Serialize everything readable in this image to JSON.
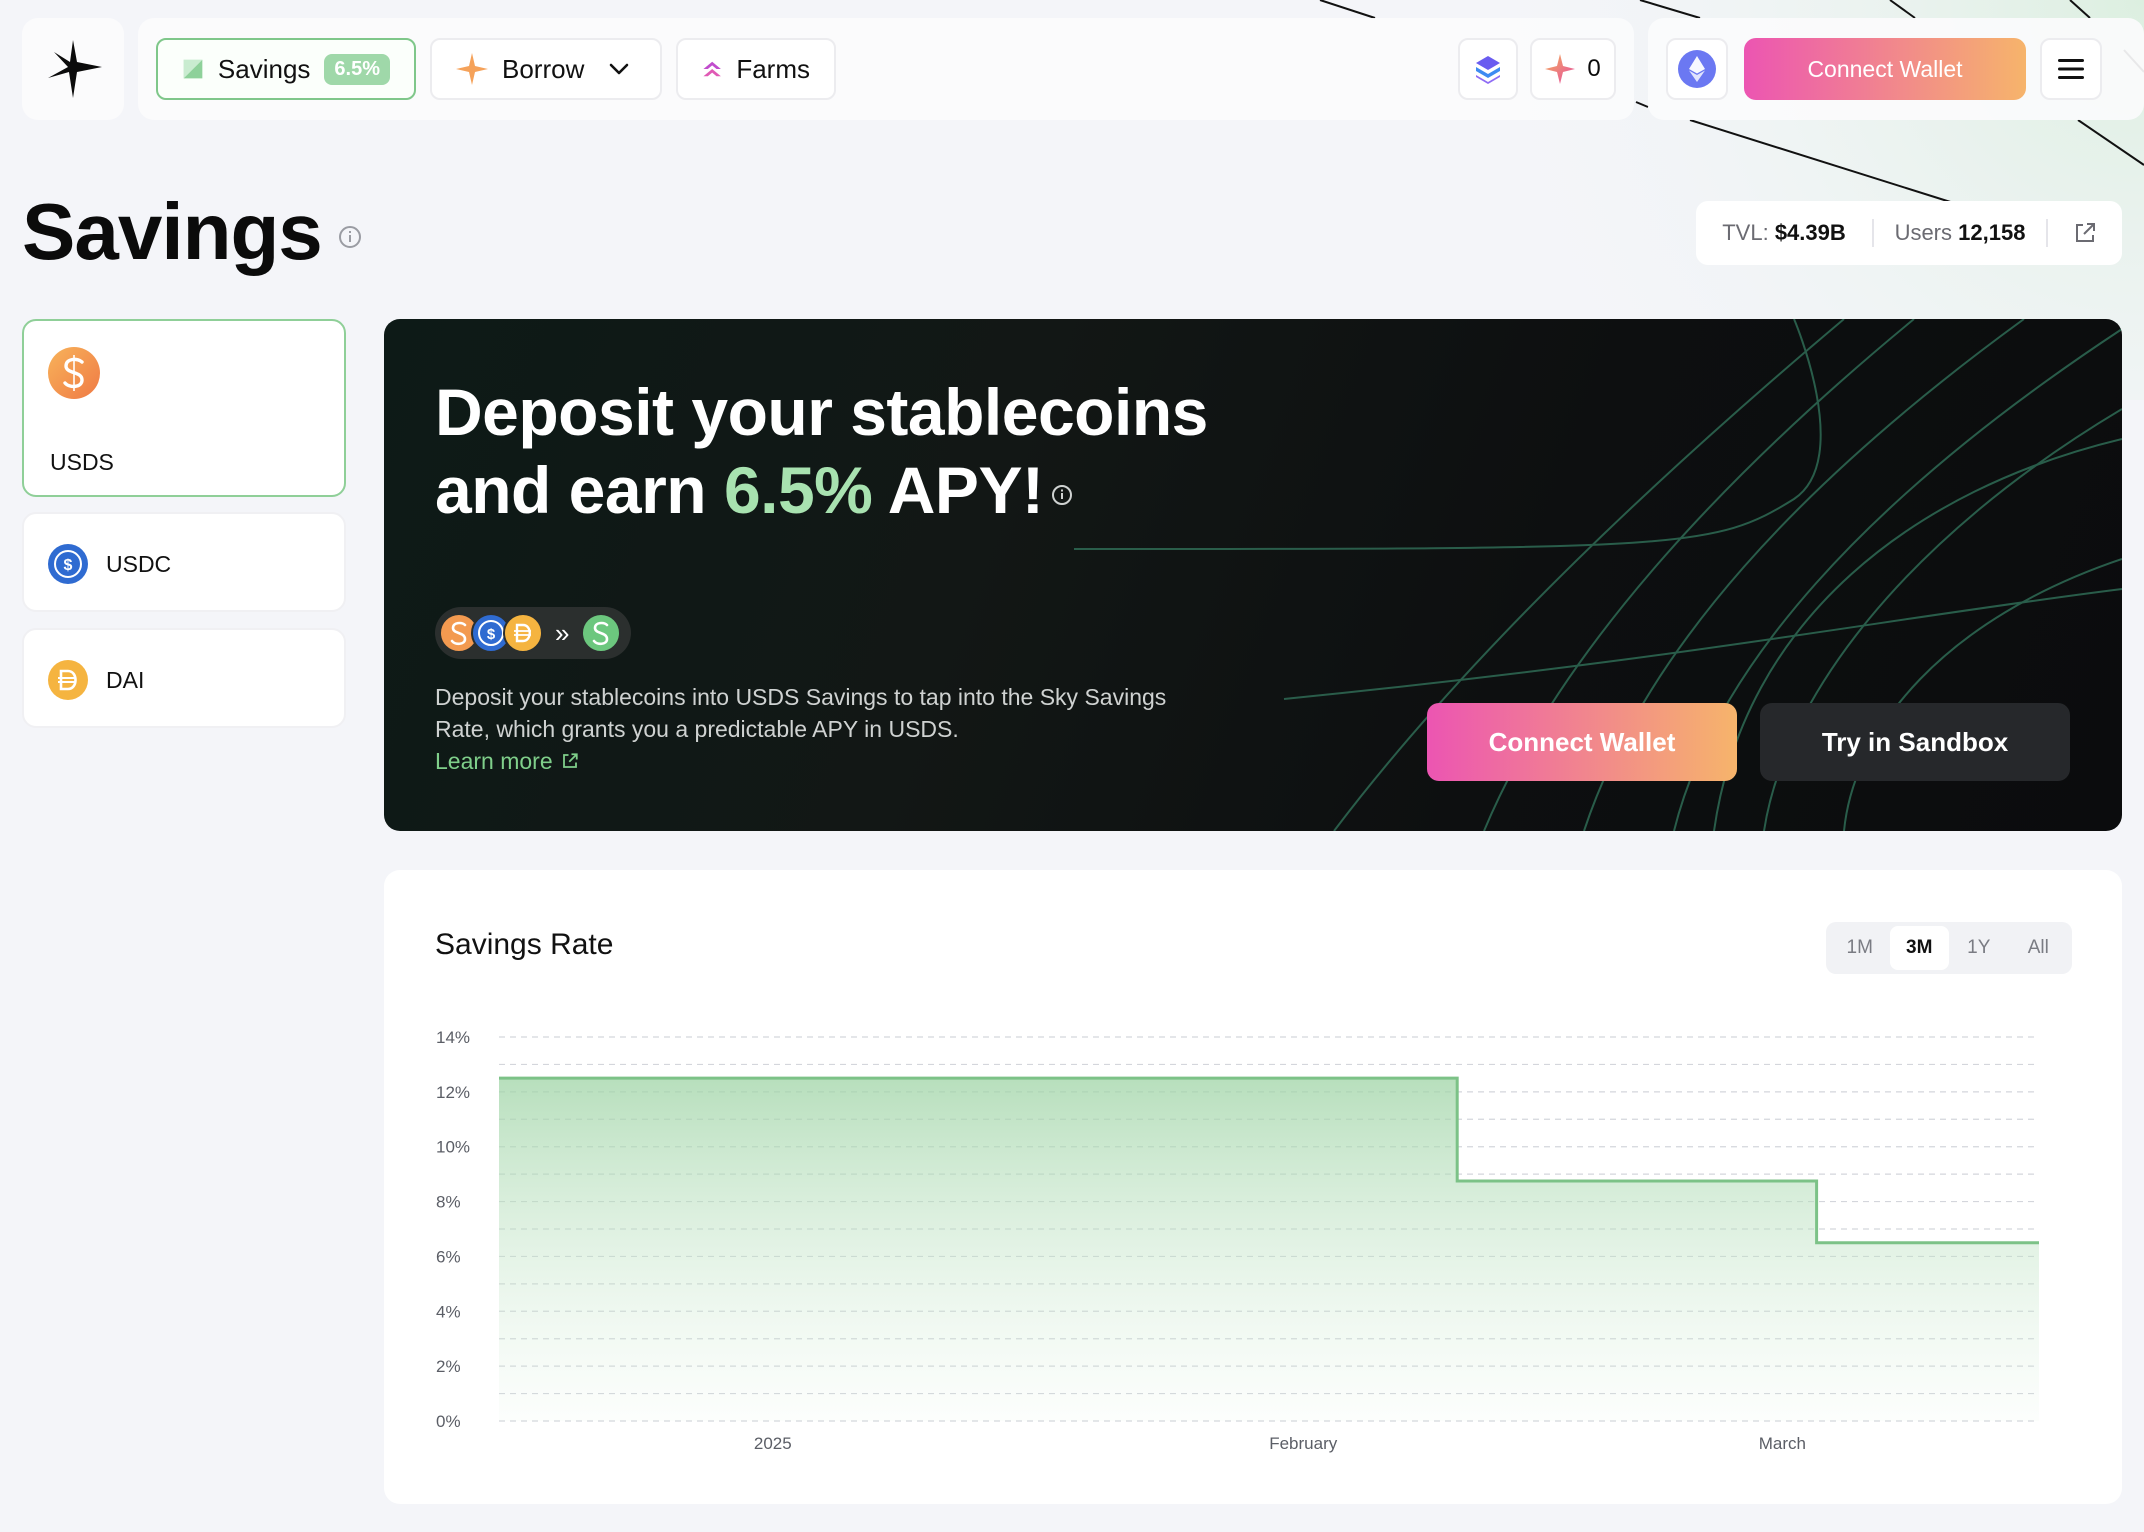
{
  "colors": {
    "accent_green": "#7fcf8a",
    "apy_green": "#a8e2b0",
    "gradient_start": "#ec55b2",
    "gradient_end": "#f6b46b",
    "hero_bg": "#0d1210",
    "chart_line": "#7cc287"
  },
  "nav": {
    "logo_icon": "sky-star-icon",
    "items": [
      {
        "label": "Savings",
        "badge": "6.5%",
        "icon": "savings-icon"
      },
      {
        "label": "Borrow",
        "icon": "borrow-sparkle-icon"
      },
      {
        "label": "Farms",
        "icon": "farms-icon"
      }
    ],
    "points_count": "0",
    "connect_wallet": "Connect Wallet"
  },
  "page": {
    "title": "Savings"
  },
  "stats": {
    "tvl_label": "TVL:",
    "tvl_value": "$4.39B",
    "users_label": "Users",
    "users_value": "12,158"
  },
  "tokens": [
    {
      "symbol": "USDS",
      "icon": "usds-icon"
    },
    {
      "symbol": "USDC",
      "icon": "usdc-icon"
    },
    {
      "symbol": "DAI",
      "icon": "dai-icon"
    }
  ],
  "hero": {
    "line1": "Deposit your stablecoins",
    "line2_prefix": "and earn ",
    "apy": "6.5%",
    "line2_suffix": " APY!",
    "flow_arrow": "»",
    "description": "Deposit your stablecoins into USDS Savings to tap into the Sky Savings Rate, which grants you a predictable APY in USDS.",
    "learn_more": "Learn more",
    "connect_wallet": "Connect Wallet",
    "sandbox": "Try in Sandbox"
  },
  "chart": {
    "title": "Savings Rate",
    "ranges": [
      "1M",
      "3M",
      "1Y",
      "All"
    ],
    "active_range": "3M"
  },
  "chart_data": {
    "type": "area",
    "title": "Savings Rate",
    "xlabel": "",
    "ylabel": "",
    "x_ticks": [
      "2025",
      "February",
      "March"
    ],
    "y_ticks": [
      "0%",
      "2%",
      "4%",
      "6%",
      "8%",
      "10%",
      "12%",
      "14%"
    ],
    "ylim": [
      0,
      14
    ],
    "step": true,
    "series": [
      {
        "x": [
          "2024-12-16",
          "2025-02-10",
          "2025-02-10",
          "2025-03-03",
          "2025-03-03",
          "2025-03-16"
        ],
        "values": [
          12.5,
          12.5,
          8.75,
          8.75,
          6.5,
          6.5
        ]
      }
    ],
    "grid": true
  }
}
